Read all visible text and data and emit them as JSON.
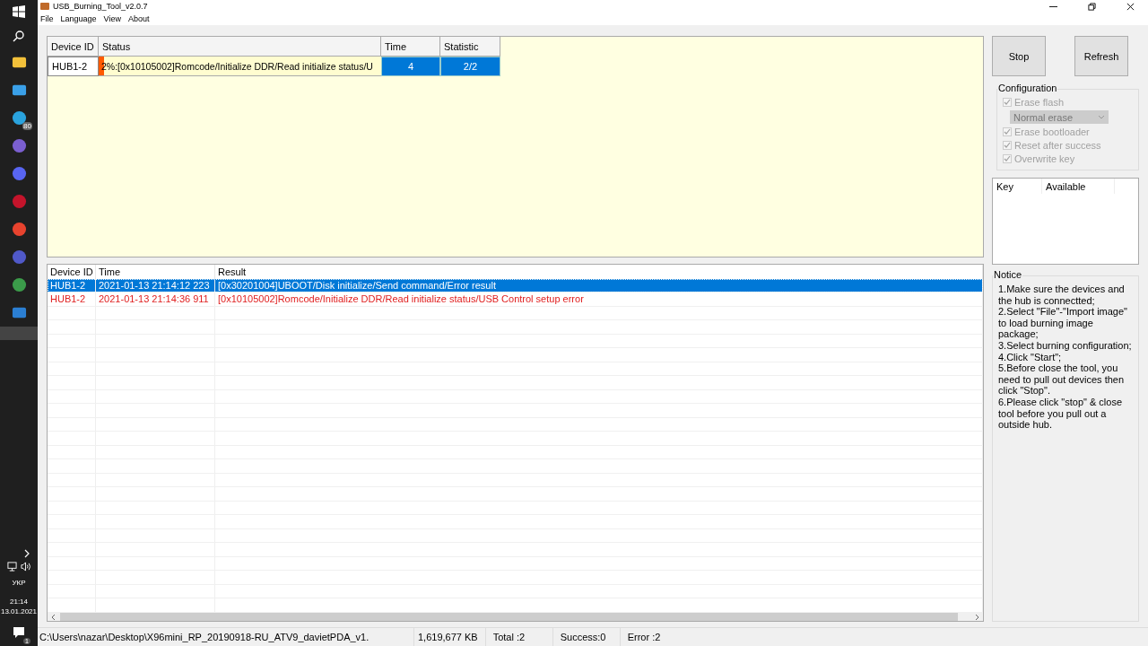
{
  "taskbar": {
    "apps": [
      {
        "kind": "folder",
        "selected": false
      },
      {
        "kind": "computer",
        "selected": false
      },
      {
        "kind": "telegram",
        "badge": "80",
        "selected": false
      },
      {
        "kind": "viber",
        "selected": false
      },
      {
        "kind": "discord",
        "selected": false
      },
      {
        "kind": "opera",
        "selected": false
      },
      {
        "kind": "hand",
        "selected": false
      },
      {
        "kind": "teams",
        "selected": false
      },
      {
        "kind": "chrome",
        "selected": false
      },
      {
        "kind": "mail",
        "selected": false
      },
      {
        "kind": "tool",
        "selected": true
      }
    ],
    "language": "УКР",
    "time": "21:14",
    "date": "13.01.2021",
    "notification_count": "1"
  },
  "window": {
    "title": "USB_Burning_Tool_v2.0.7"
  },
  "menu": [
    "File",
    "Language",
    "View",
    "About"
  ],
  "device_table": {
    "columns": [
      "Device ID",
      "Status",
      "Time",
      "Statistic"
    ],
    "rows": [
      {
        "device_id": "HUB1-2",
        "status": "2%:[0x10105002]Romcode/Initialize DDR/Read initialize status/U",
        "level": 0.02,
        "time": "4",
        "statistic": "2/2"
      }
    ]
  },
  "log_table": {
    "columns": [
      "Device ID",
      "Time",
      "Result"
    ],
    "rows": [
      {
        "device_id": "HUB1-2",
        "time": "2021-01-13 21:14:12 223",
        "result": "[0x30201004]UBOOT/Disk initialize/Send command/Error result",
        "selected": true,
        "error": false
      },
      {
        "device_id": "HUB1-2",
        "time": "2021-01-13 21:14:36 911",
        "result": "[0x10105002]Romcode/Initialize DDR/Read initialize status/USB Control setup error",
        "selected": false,
        "error": true
      }
    ]
  },
  "buttons": [
    "Stop",
    "Refresh"
  ],
  "configuration": {
    "title": "Configuration",
    "options": [
      {
        "kind": "checkbox",
        "label": "Erase flash",
        "checked": true,
        "disabled": true
      },
      {
        "kind": "select",
        "value": "Normal erase",
        "disabled": true
      },
      {
        "kind": "checkbox",
        "label": "Erase bootloader",
        "checked": true,
        "disabled": true
      },
      {
        "kind": "checkbox",
        "label": "Reset after success",
        "checked": true,
        "disabled": true
      },
      {
        "kind": "checkbox",
        "label": "Overwrite key",
        "checked": true,
        "disabled": true
      }
    ]
  },
  "key_table": {
    "columns": [
      "Key",
      "Available"
    ]
  },
  "notice": {
    "title": "Notice",
    "lines": [
      "1.Make sure the devices and the hub is connectted;",
      "2.Select \"File\"-\"Import image\" to load burning image package;",
      "3.Select burning configuration;",
      "4.Click \"Start\";",
      "5.Before close the tool, you need to pull out devices then click \"Stop\".",
      "6.Please click \"stop\" & close tool before you pull out a outside hub."
    ]
  },
  "status_bar": {
    "path": "C:\\Users\\nazar\\Desktop\\X96mini_RP_20190918-RU_ATV9_davietPDA_v1.",
    "size": "1,619,677 KB",
    "total": "Total :2",
    "success": "Success:0",
    "error": "Error :2"
  }
}
